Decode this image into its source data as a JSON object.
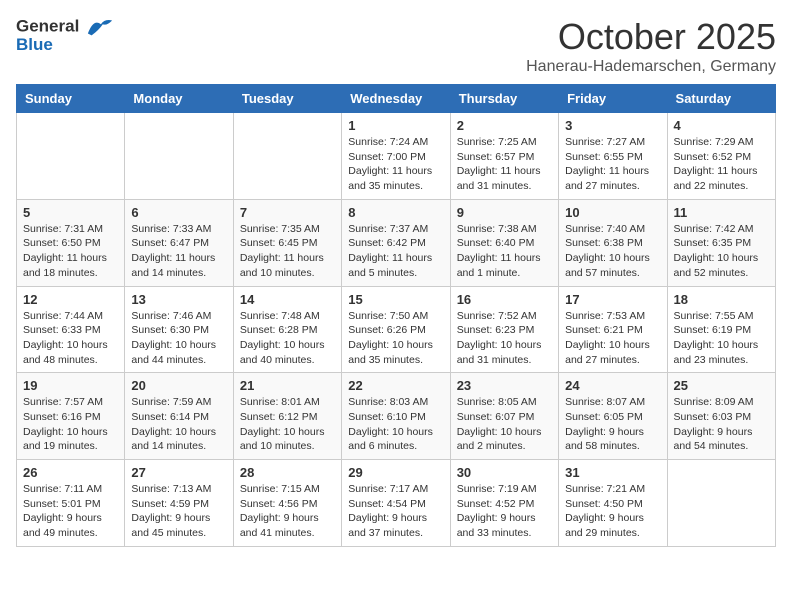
{
  "header": {
    "logo_general": "General",
    "logo_blue": "Blue",
    "month": "October 2025",
    "location": "Hanerau-Hademarschen, Germany"
  },
  "weekdays": [
    "Sunday",
    "Monday",
    "Tuesday",
    "Wednesday",
    "Thursday",
    "Friday",
    "Saturday"
  ],
  "weeks": [
    [
      {
        "day": "",
        "info": ""
      },
      {
        "day": "",
        "info": ""
      },
      {
        "day": "",
        "info": ""
      },
      {
        "day": "1",
        "info": "Sunrise: 7:24 AM\nSunset: 7:00 PM\nDaylight: 11 hours\nand 35 minutes."
      },
      {
        "day": "2",
        "info": "Sunrise: 7:25 AM\nSunset: 6:57 PM\nDaylight: 11 hours\nand 31 minutes."
      },
      {
        "day": "3",
        "info": "Sunrise: 7:27 AM\nSunset: 6:55 PM\nDaylight: 11 hours\nand 27 minutes."
      },
      {
        "day": "4",
        "info": "Sunrise: 7:29 AM\nSunset: 6:52 PM\nDaylight: 11 hours\nand 22 minutes."
      }
    ],
    [
      {
        "day": "5",
        "info": "Sunrise: 7:31 AM\nSunset: 6:50 PM\nDaylight: 11 hours\nand 18 minutes."
      },
      {
        "day": "6",
        "info": "Sunrise: 7:33 AM\nSunset: 6:47 PM\nDaylight: 11 hours\nand 14 minutes."
      },
      {
        "day": "7",
        "info": "Sunrise: 7:35 AM\nSunset: 6:45 PM\nDaylight: 11 hours\nand 10 minutes."
      },
      {
        "day": "8",
        "info": "Sunrise: 7:37 AM\nSunset: 6:42 PM\nDaylight: 11 hours\nand 5 minutes."
      },
      {
        "day": "9",
        "info": "Sunrise: 7:38 AM\nSunset: 6:40 PM\nDaylight: 11 hours\nand 1 minute."
      },
      {
        "day": "10",
        "info": "Sunrise: 7:40 AM\nSunset: 6:38 PM\nDaylight: 10 hours\nand 57 minutes."
      },
      {
        "day": "11",
        "info": "Sunrise: 7:42 AM\nSunset: 6:35 PM\nDaylight: 10 hours\nand 52 minutes."
      }
    ],
    [
      {
        "day": "12",
        "info": "Sunrise: 7:44 AM\nSunset: 6:33 PM\nDaylight: 10 hours\nand 48 minutes."
      },
      {
        "day": "13",
        "info": "Sunrise: 7:46 AM\nSunset: 6:30 PM\nDaylight: 10 hours\nand 44 minutes."
      },
      {
        "day": "14",
        "info": "Sunrise: 7:48 AM\nSunset: 6:28 PM\nDaylight: 10 hours\nand 40 minutes."
      },
      {
        "day": "15",
        "info": "Sunrise: 7:50 AM\nSunset: 6:26 PM\nDaylight: 10 hours\nand 35 minutes."
      },
      {
        "day": "16",
        "info": "Sunrise: 7:52 AM\nSunset: 6:23 PM\nDaylight: 10 hours\nand 31 minutes."
      },
      {
        "day": "17",
        "info": "Sunrise: 7:53 AM\nSunset: 6:21 PM\nDaylight: 10 hours\nand 27 minutes."
      },
      {
        "day": "18",
        "info": "Sunrise: 7:55 AM\nSunset: 6:19 PM\nDaylight: 10 hours\nand 23 minutes."
      }
    ],
    [
      {
        "day": "19",
        "info": "Sunrise: 7:57 AM\nSunset: 6:16 PM\nDaylight: 10 hours\nand 19 minutes."
      },
      {
        "day": "20",
        "info": "Sunrise: 7:59 AM\nSunset: 6:14 PM\nDaylight: 10 hours\nand 14 minutes."
      },
      {
        "day": "21",
        "info": "Sunrise: 8:01 AM\nSunset: 6:12 PM\nDaylight: 10 hours\nand 10 minutes."
      },
      {
        "day": "22",
        "info": "Sunrise: 8:03 AM\nSunset: 6:10 PM\nDaylight: 10 hours\nand 6 minutes."
      },
      {
        "day": "23",
        "info": "Sunrise: 8:05 AM\nSunset: 6:07 PM\nDaylight: 10 hours\nand 2 minutes."
      },
      {
        "day": "24",
        "info": "Sunrise: 8:07 AM\nSunset: 6:05 PM\nDaylight: 9 hours\nand 58 minutes."
      },
      {
        "day": "25",
        "info": "Sunrise: 8:09 AM\nSunset: 6:03 PM\nDaylight: 9 hours\nand 54 minutes."
      }
    ],
    [
      {
        "day": "26",
        "info": "Sunrise: 7:11 AM\nSunset: 5:01 PM\nDaylight: 9 hours\nand 49 minutes."
      },
      {
        "day": "27",
        "info": "Sunrise: 7:13 AM\nSunset: 4:59 PM\nDaylight: 9 hours\nand 45 minutes."
      },
      {
        "day": "28",
        "info": "Sunrise: 7:15 AM\nSunset: 4:56 PM\nDaylight: 9 hours\nand 41 minutes."
      },
      {
        "day": "29",
        "info": "Sunrise: 7:17 AM\nSunset: 4:54 PM\nDaylight: 9 hours\nand 37 minutes."
      },
      {
        "day": "30",
        "info": "Sunrise: 7:19 AM\nSunset: 4:52 PM\nDaylight: 9 hours\nand 33 minutes."
      },
      {
        "day": "31",
        "info": "Sunrise: 7:21 AM\nSunset: 4:50 PM\nDaylight: 9 hours\nand 29 minutes."
      },
      {
        "day": "",
        "info": ""
      }
    ]
  ]
}
